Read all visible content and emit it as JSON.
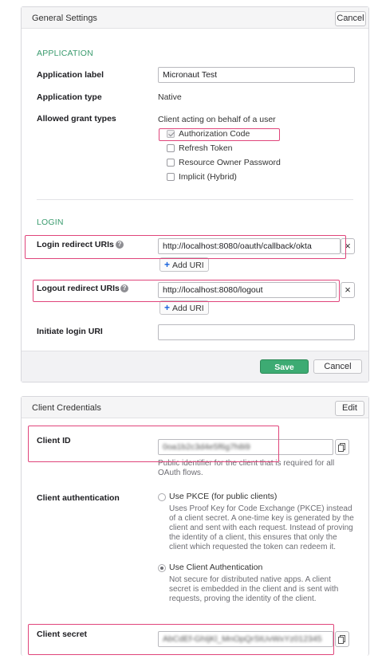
{
  "general": {
    "title": "General Settings",
    "cancel_label": "Cancel",
    "application_heading": "APPLICATION",
    "app_label_label": "Application label",
    "app_label_value": "Micronaut Test",
    "app_type_label": "Application type",
    "app_type_value": "Native",
    "grant_types_label": "Allowed grant types",
    "grant_types_subtitle": "Client acting on behalf of a user",
    "grant_options": [
      {
        "label": "Authorization Code",
        "checked": true
      },
      {
        "label": "Refresh Token",
        "checked": false
      },
      {
        "label": "Resource Owner Password",
        "checked": false
      },
      {
        "label": "Implicit (Hybrid)",
        "checked": false
      }
    ],
    "login_heading": "LOGIN",
    "login_redirect_label": "Login redirect URIs",
    "login_redirect_value": "http://localhost:8080/oauth/callback/okta",
    "logout_redirect_label": "Logout redirect URIs",
    "logout_redirect_value": "http://localhost:8080/logout",
    "add_uri_label": "Add URI",
    "initiate_login_label": "Initiate login URI",
    "initiate_login_value": "",
    "save_label": "Save",
    "footer_cancel_label": "Cancel"
  },
  "credentials": {
    "title": "Client Credentials",
    "edit_label": "Edit",
    "client_id_label": "Client ID",
    "client_id_value": "0oa1b2c3d4e5f6g7h8i9",
    "client_id_help": "Public identifier for the client that is required for all OAuth flows.",
    "client_auth_label": "Client authentication",
    "options": [
      {
        "label": "Use PKCE (for public clients)",
        "selected": false,
        "description": "Uses Proof Key for Code Exchange (PKCE) instead of a client secret. A one-time key is generated by the client and sent with each request. Instead of proving the identity of a client, this ensures that only the client which requested the token can redeem it."
      },
      {
        "label": "Use Client Authentication",
        "selected": true,
        "description": "Not secure for distributed native apps. A client secret is embedded in the client and is sent with requests, proving the identity of the client."
      }
    ],
    "client_secret_label": "Client secret",
    "client_secret_value": "AbCdEf-GhIjKl_MnOpQrStUvWxYz012345"
  },
  "colors": {
    "accent_green": "#3a9b6e",
    "save_button": "#3dab73",
    "highlight": "#e0457b"
  }
}
